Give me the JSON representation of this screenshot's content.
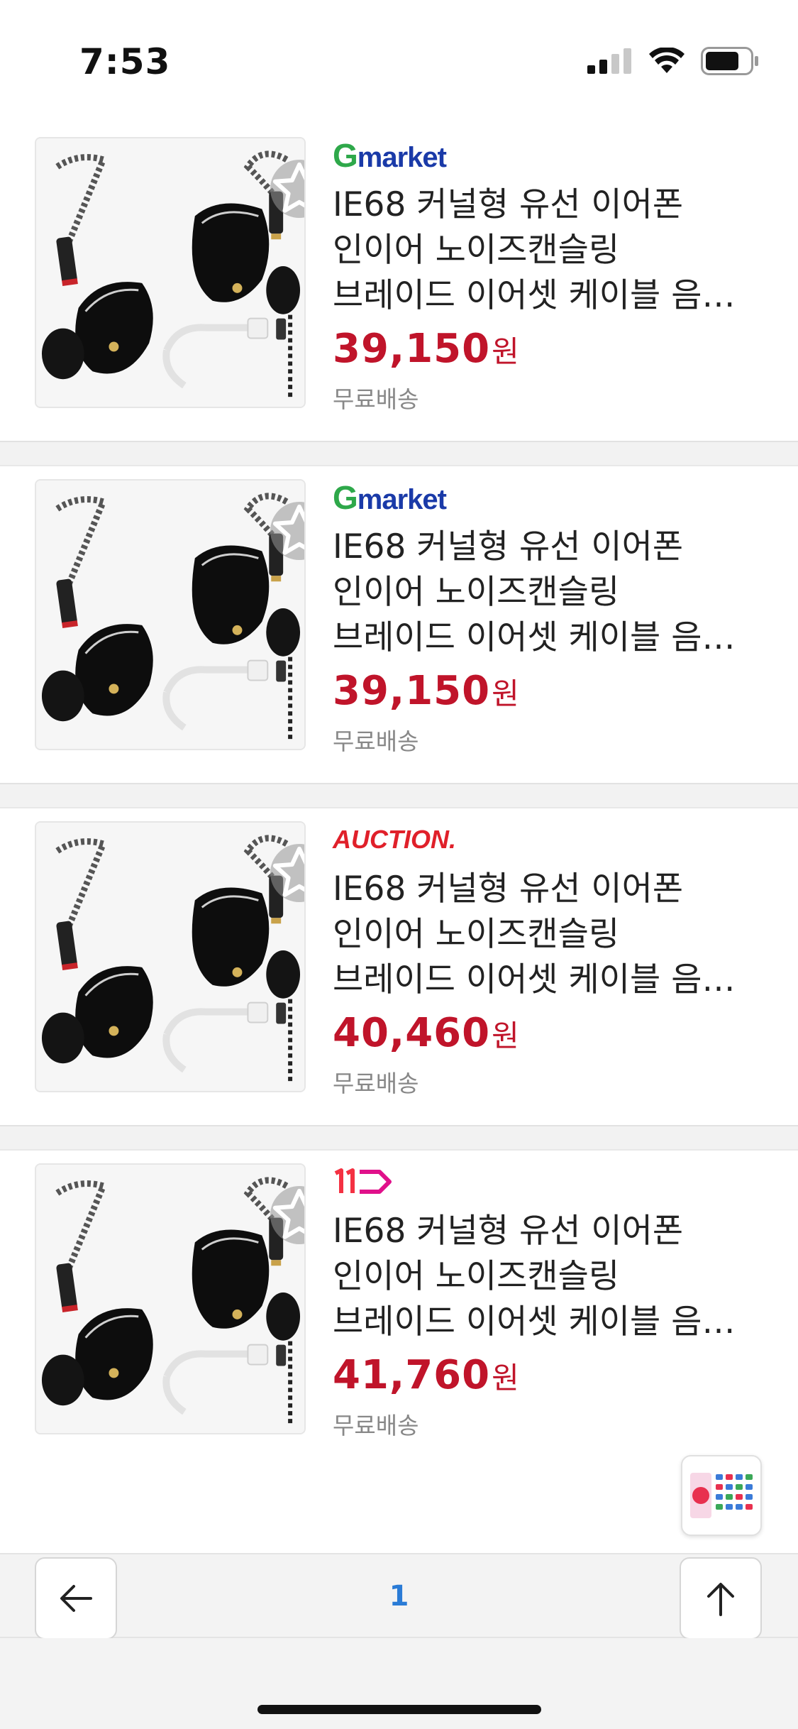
{
  "status": {
    "time": "7:53"
  },
  "products": [
    {
      "seller": "Gmarket",
      "title_lines": [
        "IE68 커널형 유선 이어폰",
        "인이어 노이즈캔슬링",
        "브레이드 이어셋 케이블 음…"
      ],
      "price": "39,150",
      "currency": "원",
      "shipping": "무료배송"
    },
    {
      "seller": "Gmarket",
      "title_lines": [
        "IE68 커널형 유선 이어폰",
        "인이어 노이즈캔슬링",
        "브레이드 이어셋 케이블 음…"
      ],
      "price": "39,150",
      "currency": "원",
      "shipping": "무료배송"
    },
    {
      "seller": "AUCTION.",
      "title_lines": [
        "IE68 커널형 유선 이어폰",
        "인이어 노이즈캔슬링",
        "브레이드 이어셋 케이블 음…"
      ],
      "price": "40,460",
      "currency": "원",
      "shipping": "무료배송"
    },
    {
      "seller": "11",
      "title_lines": [
        "IE68 커널형 유선 이어폰",
        "인이어 노이즈캔슬링",
        "브레이드 이어셋 케이블 음…"
      ],
      "price": "41,760",
      "currency": "원",
      "shipping": "무료배송"
    }
  ],
  "pagination": {
    "current_page": "1"
  },
  "colors": {
    "price": "#c0142a",
    "page_number": "#2a7bd6",
    "gmarket_green": "#2ea84a",
    "gmarket_blue": "#1a3aa8",
    "auction_red": "#e0202a",
    "elevenst": "#f43142"
  }
}
